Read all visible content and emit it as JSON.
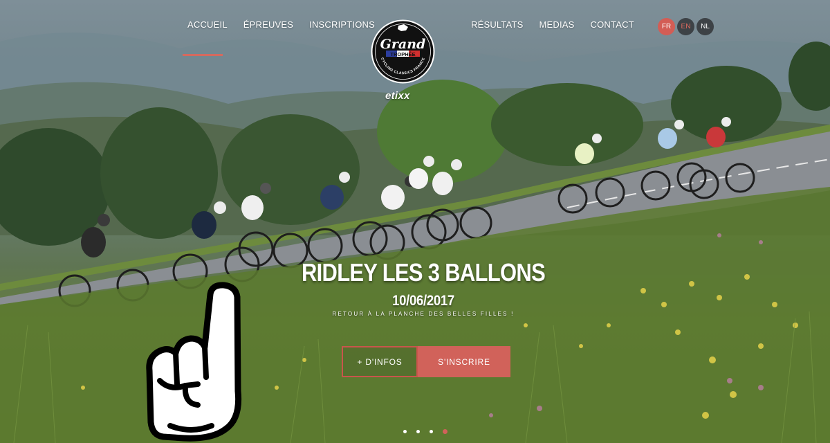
{
  "nav": {
    "left": [
      {
        "label": "ACCUEIL",
        "active": true
      },
      {
        "label": "ÉPREUVES"
      },
      {
        "label": "INSCRIPTIONS"
      }
    ],
    "right": [
      {
        "label": "RÉSULTATS"
      },
      {
        "label": "MEDIAS"
      },
      {
        "label": "CONTACT"
      }
    ]
  },
  "languages": [
    {
      "code": "FR",
      "active": true
    },
    {
      "code": "EN"
    },
    {
      "code": "NL"
    }
  ],
  "logo": {
    "line1": "Grand",
    "line2": "TROPHÉE",
    "ring": "CYCLING CLASSICS FRANCE",
    "sponsor": "etixx"
  },
  "slide": {
    "title": "RIDLEY LES 3 BALLONS",
    "date": "10/06/2017",
    "subtitle": "RETOUR À LA PLANCHE DES BELLES FILLES !",
    "info_button": "+ D'INFOS",
    "signup_button": "S'INSCRIRE"
  },
  "carousel": {
    "count": 4,
    "active_index": 3
  },
  "colors": {
    "accent": "#d1625a",
    "dark": "#3d4246"
  }
}
